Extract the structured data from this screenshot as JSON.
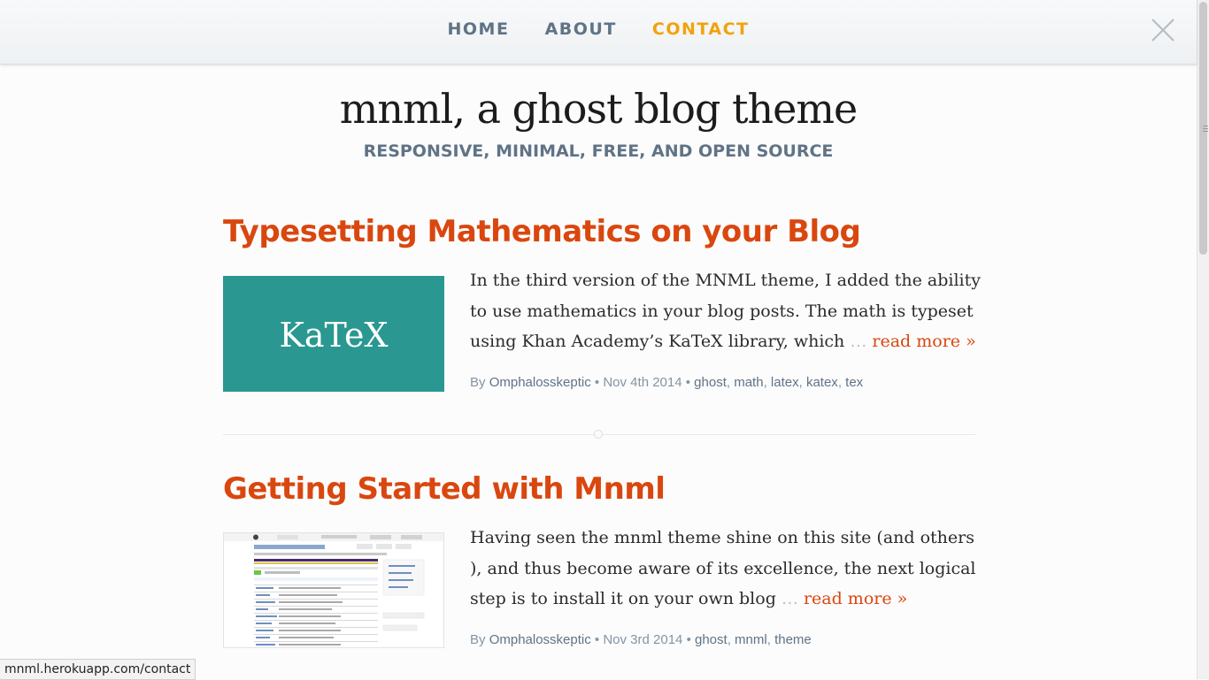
{
  "nav": {
    "items": [
      {
        "label": "HOME"
      },
      {
        "label": "ABOUT"
      },
      {
        "label": "CONTACT"
      }
    ]
  },
  "site": {
    "title": "mnml, a ghost blog theme",
    "subtitle": "RESPONSIVE, MINIMAL, FREE, AND OPEN SOURCE"
  },
  "posts": [
    {
      "title": "Typesetting Mathematics on your Blog",
      "excerpt": "In the third version of the MNML theme, I added the ability to use mathematics in your blog posts. The math is typeset using Khan Academy’s KaTeX library, which",
      "ellipsis": "…",
      "read_more": "read more »",
      "thumb_text": "KaTeX",
      "meta_by": "By",
      "author": "Omphalosskeptic",
      "date": "Nov 4th 2014",
      "tags": [
        "ghost",
        "math",
        "latex",
        "katex",
        "tex"
      ]
    },
    {
      "title": "Getting Started with Mnml",
      "excerpt": "Having seen the mnml theme shine on this site (and others ), and thus become aware of its excellence, the next logical step is to install it on your own blog",
      "ellipsis": "…",
      "read_more": "read more »",
      "meta_by": "By",
      "author": "Omphalosskeptic",
      "date": "Nov 3rd 2014",
      "tags": [
        "ghost",
        "mnml",
        "theme"
      ]
    }
  ],
  "status_bar": {
    "url": "mnml.herokuapp.com/contact"
  },
  "colors": {
    "accent": "#d9470f",
    "nav_active": "#f2a20b",
    "nav": "#607386",
    "katex_bg": "#2a9890"
  }
}
